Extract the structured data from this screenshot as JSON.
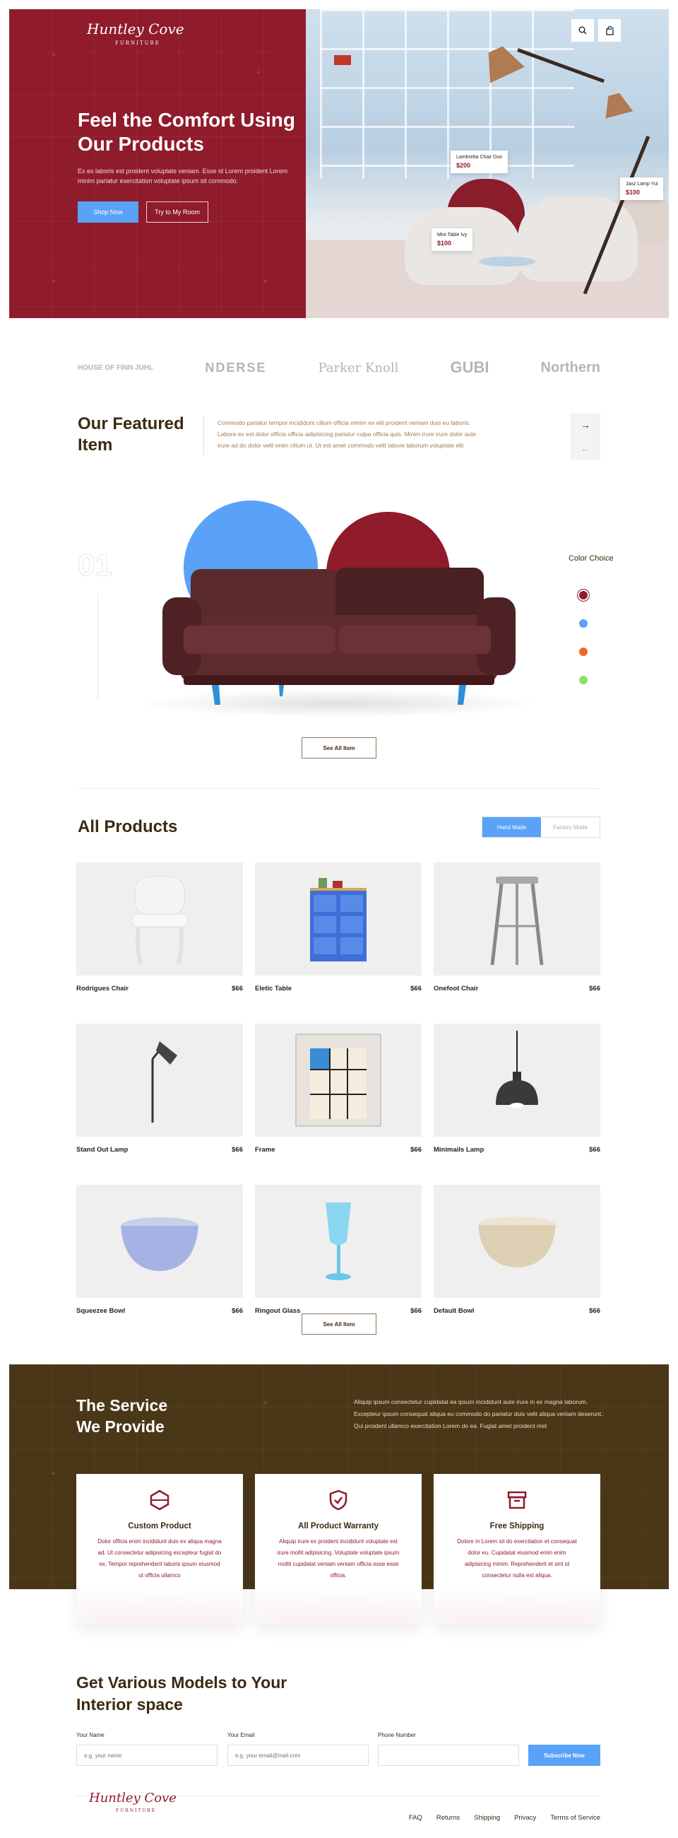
{
  "brand": {
    "name": "Huntley Cove",
    "sub": "FURNITURE"
  },
  "hero": {
    "title": "Feel the Comfort Using Our Products",
    "desc": "Ex ex laboris est proident voluptate veniam. Esse id Lorem proident Lorem minim pariatur exercitation voluptate ipsum sit commodo.",
    "primary_btn": "Shop Now",
    "secondary_btn": "Try to My Room",
    "tags": [
      {
        "name": "Lambretta Chair Duo",
        "price": "$200"
      },
      {
        "name": "Jaxz Lamp Yui",
        "price": "$100"
      },
      {
        "name": "Mini Table Ivy",
        "price": "$100"
      }
    ]
  },
  "brands": [
    "HOUSE OF FINN JUHL",
    "NDERSE",
    "Parker Knoll",
    "GUBI",
    "Northern"
  ],
  "featured": {
    "title": "Our Featured Item",
    "desc": "Commodo pariatur tempor incididunt cillum officia minim ex elit proident veniam duis eu laboris. Labore ex est dolor officia officia adipisicing pariatur culpa officia quis. Minim irure irure dolor aute irure ad do dolor velit enim cillum ut. Ut est amet commodo velit labore laborum voluptate elit",
    "number": "01",
    "color_label": "Color Choice",
    "colors": [
      "#8f1b2b",
      "#5aa2f7",
      "#f0662a",
      "#8ee060"
    ],
    "see_all": "See All Item"
  },
  "products": {
    "title": "All Products",
    "tabs": [
      "Hand Made",
      "Factory Made"
    ],
    "items": [
      {
        "name": "Rodrigues Chair",
        "price": "$66"
      },
      {
        "name": "Eletic Table",
        "price": "$66"
      },
      {
        "name": "Onefoot Chair",
        "price": "$66"
      },
      {
        "name": "Stand Out Lamp",
        "price": "$66"
      },
      {
        "name": "Frame",
        "price": "$66"
      },
      {
        "name": "Minimails Lamp",
        "price": "$66"
      },
      {
        "name": "Squeezee Bowl",
        "price": "$66"
      },
      {
        "name": "Ringout Glass",
        "price": "$66"
      },
      {
        "name": "Default Bowl",
        "price": "$66"
      }
    ],
    "see_all": "See All Item"
  },
  "service": {
    "title": "The Service We Provide",
    "desc": "Aliquip ipsum consectetur cupidatat ea ipsum incididunt aute irure in ex magna laborum. Excepteur ipsum consequat aliqua eu commodo do pariatur duis velit aliqua veniam deserunt. Qui proident ullamco exercitation Lorem do ea. Fugiat amet proident met",
    "cards": [
      {
        "title": "Custom Product",
        "desc": "Dolor officia enim incididunt duis ex aliqua magna ad. Ut consectetur adipisicing excepteur fugiat do ex. Tempor reprehenderit laboris ipsum eiusmod ut officia ullamco"
      },
      {
        "title": "All Product Warranty",
        "desc": "Aliquip irure ex proident incididunt voluptate est irure mollit adipisicing. Voluptate voluptate ipsum mollit cupidatat veniam veniam officia esse esse officia."
      },
      {
        "title": "Free Shipping",
        "desc": "Dolore in Lorem sit do exercitation et consequat dolor eu. Cupidatat eiusmod enim enim adipisicing minim. Reprehenderit et sint id consectetur nulla est aliqua."
      }
    ]
  },
  "subscribe": {
    "title": "Get Various Models to Your Interior space",
    "name_label": "Your Name",
    "name_placeholder": "e.g. your name",
    "email_label": "Your Email",
    "email_placeholder": "e.g. your email@mail.com",
    "phone_label": "Phone Number",
    "phone_placeholder": "",
    "button": "Subscribe Now"
  },
  "footer": {
    "links": [
      "FAQ",
      "Returns",
      "Shipping",
      "Privacy",
      "Terms of Service"
    ]
  }
}
